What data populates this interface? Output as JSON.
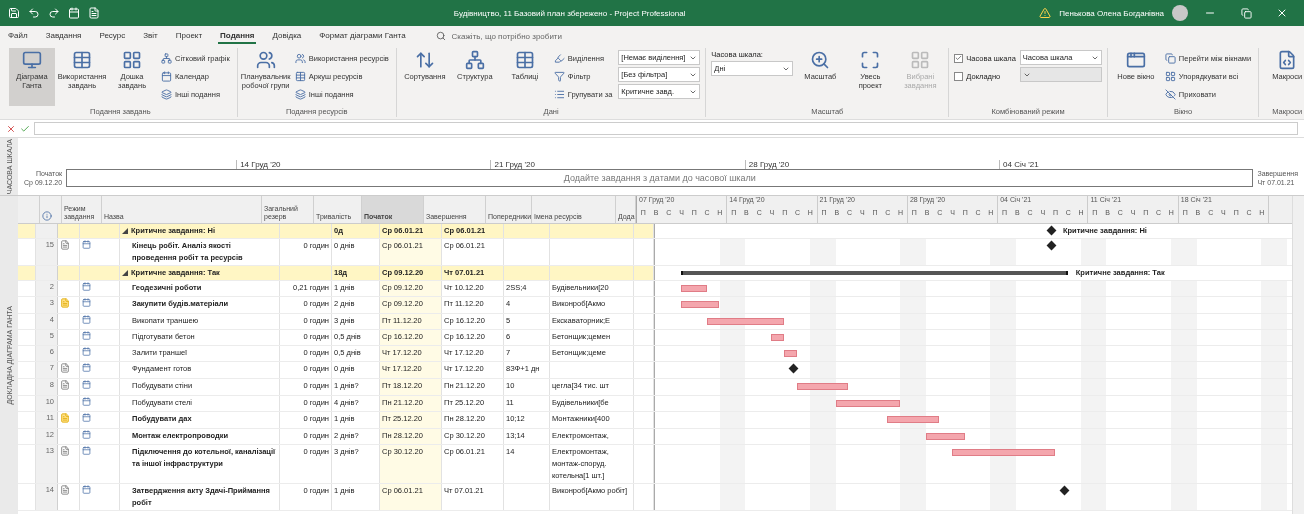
{
  "title_bar": {
    "title": "Будівництво, 11 Базовий план збережено - Project Professional",
    "user": "Пенькова Олена Богданівна"
  },
  "ribbon_tabs": [
    {
      "label": "Файл",
      "selected": false
    },
    {
      "label": "Завдання",
      "selected": false
    },
    {
      "label": "Ресурс",
      "selected": false
    },
    {
      "label": "Звіт",
      "selected": false
    },
    {
      "label": "Проект",
      "selected": false
    },
    {
      "label": "Подання",
      "selected": true
    },
    {
      "label": "Довідка",
      "selected": false
    },
    {
      "label": "Формат діаграми Ганта",
      "selected": false
    }
  ],
  "tell_me": {
    "placeholder": "Скажіть, що потрібно зробити"
  },
  "ribbon_groups": [
    {
      "title": "Подання завдань",
      "items": [
        {
          "kind": "large",
          "label": "Діаграма Ганта",
          "selected": true
        },
        {
          "kind": "large",
          "label": "Використання завдань",
          "selected": false
        },
        {
          "kind": "large",
          "label": "Дошка завдань",
          "selected": false
        },
        {
          "kind": "small",
          "label": "Сітковий графік",
          "selected": false
        },
        {
          "kind": "small",
          "label": "Календар",
          "selected": false
        },
        {
          "kind": "small",
          "label": "Інші подання",
          "selected": false
        }
      ]
    },
    {
      "title": "Подання ресурсів",
      "items": [
        {
          "kind": "large",
          "label": "Планувальник робочої групи",
          "selected": false
        },
        {
          "kind": "small",
          "label": "Використання ресурсів",
          "selected": false
        },
        {
          "kind": "small",
          "label": "Аркуш ресурсів",
          "selected": false
        },
        {
          "kind": "small",
          "label": "Інші подання",
          "selected": false
        }
      ]
    },
    {
      "title": "Дані",
      "items": [
        {
          "kind": "large",
          "label": "Сортування"
        },
        {
          "kind": "large",
          "label": "Структура"
        },
        {
          "kind": "large",
          "label": "Таблиці"
        },
        {
          "kind": "small",
          "label": "Виділення"
        },
        {
          "kind": "small",
          "label": "Фільтр"
        },
        {
          "kind": "small",
          "label": "Групувати за"
        },
        {
          "kind": "select",
          "value": "[Немає виділення]"
        },
        {
          "kind": "select",
          "value": "[Без фільтра]"
        },
        {
          "kind": "select",
          "value": "Критичне завд."
        }
      ]
    },
    {
      "title": "Масштаб",
      "items": [
        {
          "kind": "labeled_select",
          "label": "Часова шкала:",
          "value": "Дні"
        },
        {
          "kind": "large",
          "label": "Масштаб"
        },
        {
          "kind": "large",
          "label": "Увесь проект"
        },
        {
          "kind": "large",
          "label": "Вибрані завдання",
          "disabled": true
        }
      ]
    },
    {
      "title": "Комбінований режим",
      "items": [
        {
          "kind": "checkbox",
          "label": "Часова шкала",
          "checked": true
        },
        {
          "kind": "checkbox",
          "label": "Докладно",
          "checked": false
        },
        {
          "kind": "select",
          "value": "Часова шкала"
        },
        {
          "kind": "select",
          "disabled": true
        }
      ]
    },
    {
      "title": "Вікно",
      "items": [
        {
          "kind": "large",
          "label": "Нове вікно"
        },
        {
          "kind": "small",
          "label": "Перейти між вікнами"
        },
        {
          "kind": "small",
          "label": "Упорядкувати всі"
        },
        {
          "kind": "small",
          "label": "Приховати"
        }
      ]
    },
    {
      "title": "Макроси",
      "items": [
        {
          "kind": "large",
          "label": "Макроси"
        }
      ]
    }
  ],
  "timeline": {
    "label": "ЧАСОВА ШКАЛА",
    "start_label": "Початок",
    "start": "Ср 09.12.20",
    "finish_label": "Завершення",
    "finish": "Чт 07.01.21",
    "hint": "Додайте завдання з датами до часової шкали",
    "ticks": [
      "14 Груд '20",
      "21 Груд '20",
      "28 Груд '20",
      "04 Січ '21"
    ]
  },
  "table": {
    "side_label": "ДОКЛАДНА ДІАГРАМА ГАНТА",
    "columns": [
      {
        "label": "Режим завдання",
        "selected": false
      },
      {
        "label": "Назва",
        "selected": false
      },
      {
        "label": "Загальний резерв",
        "selected": false
      },
      {
        "label": "Тривалість",
        "selected": false
      },
      {
        "label": "Початок",
        "selected": true
      },
      {
        "label": "Завершення",
        "selected": false
      },
      {
        "label": "Попередники",
        "selected": false
      },
      {
        "label": "Імена ресурсів",
        "selected": false
      },
      {
        "label": "Дода",
        "selected": false
      }
    ],
    "groups": [
      {
        "label": "Критичне завдання: Ні",
        "duration": "0д",
        "start": "Ср 06.01.21",
        "finish": "Ср 06.01.21",
        "gantt_label": "Критичне завдання: Ні",
        "tasks": [
          {
            "kind": "milestone",
            "id": "15",
            "indicator": {
              "kind": "note"
            },
            "name": "Кінець робіт. Аналіз якості проведення робіт та ресурсів",
            "bold": true,
            "slack": "0 годин",
            "duration": "0 днів",
            "start": "Ср 06.01.21",
            "finish": "Ср 06.01.21"
          }
        ]
      },
      {
        "label": "Критичне завдання: Так",
        "duration": "18д",
        "start": "Ср 09.12.20",
        "finish": "Чт 07.01.21",
        "gantt_label": "Критичне завдання: Так",
        "tasks": [
          {
            "kind": "task",
            "id": "2",
            "name": "Геодезичні роботи",
            "bold": true,
            "slack": "0,21 годин",
            "duration": "1 днів",
            "start": "Ср 09.12.20",
            "finish": "Чт 10.12.20",
            "predecessors": "2SS;4",
            "resources": "Будівельники[20"
          },
          {
            "kind": "task",
            "id": "3",
            "indicator": {
              "kind": "flag"
            },
            "name": "Закупити будів.матеріали",
            "bold": true,
            "slack": "0 годин",
            "duration": "2 днів",
            "start": "Ср 09.12.20",
            "finish": "Пт 11.12.20",
            "predecessors": "4",
            "resources": "Виконроб[Акмо"
          },
          {
            "kind": "task",
            "id": "4",
            "name": "Викопати траншею",
            "bold": false,
            "slack": "0 годин",
            "duration": "3 днів",
            "start": "Пт 11.12.20",
            "finish": "Ср 16.12.20",
            "predecessors": "5",
            "resources": "Екскаваторник;Е"
          },
          {
            "kind": "task",
            "id": "5",
            "name": "Підготувати бетон",
            "bold": false,
            "slack": "0 годин",
            "duration": "0,5 днів",
            "start": "Ср 16.12.20",
            "finish": "Ср 16.12.20",
            "predecessors": "6",
            "resources": "Бетонщик;цемен"
          },
          {
            "kind": "task",
            "id": "6",
            "name": "Залити траншеї",
            "bold": false,
            "slack": "0 годин",
            "duration": "0,5 днів",
            "start": "Чт 17.12.20",
            "finish": "Чт 17.12.20",
            "predecessors": "7",
            "resources": "Бетонщик;цеме"
          },
          {
            "kind": "milestone",
            "id": "7",
            "indicator": {
              "kind": "note"
            },
            "name": "Фундамент готов",
            "bold": false,
            "slack": "0 годин",
            "duration": "0 днів",
            "start": "Чт 17.12.20",
            "finish": "Чт 17.12.20",
            "predecessors": "8ЗФ+1 дн"
          },
          {
            "kind": "task",
            "id": "8",
            "indicator": {
              "kind": "note"
            },
            "name": "Побудувати стіни",
            "bold": false,
            "slack": "0 годин",
            "duration": "1 днів?",
            "start": "Пт 18.12.20",
            "finish": "Пн 21.12.20",
            "predecessors": "10",
            "resources": "цегла[34 тис. шт"
          },
          {
            "kind": "task",
            "id": "10",
            "name": "Побудувати стелі",
            "bold": false,
            "slack": "0 годин",
            "duration": "4 днів?",
            "start": "Пн 21.12.20",
            "finish": "Пт 25.12.20",
            "predecessors": "11",
            "resources": "Будівельники[бе"
          },
          {
            "kind": "task",
            "id": "11",
            "indicator": {
              "kind": "flag"
            },
            "name": "Побудувати дах",
            "bold": true,
            "slack": "0 годин",
            "duration": "1 днів",
            "start": "Пт 25.12.20",
            "finish": "Пн 28.12.20",
            "predecessors": "10;12",
            "resources": "Монтажники[400"
          },
          {
            "kind": "task",
            "id": "12",
            "name": "Монтаж електропроводки",
            "bold": true,
            "slack": "0 годин",
            "duration": "2 днів?",
            "start": "Пн 28.12.20",
            "finish": "Ср 30.12.20",
            "predecessors": "13;14",
            "resources": "Електромонтаж,"
          },
          {
            "kind": "task",
            "id": "13",
            "indicator": {
              "kind": "note"
            },
            "name": "Підключення до котельної, каналізації та іншої інфраструктури",
            "bold": true,
            "slack": "0 годин",
            "duration": "3 днів?",
            "start": "Ср 30.12.20",
            "finish": "Ср 06.01.21",
            "predecessors": "14",
            "resources": "Електромонтаж, монтаж-споруд. котельна[1 шт.]"
          },
          {
            "kind": "milestone",
            "id": "14",
            "indicator": {
              "kind": "note"
            },
            "name": "Затвердження акту Здачі-Приймання робіт",
            "bold": true,
            "slack": "0 годин",
            "duration": "1 днів",
            "start": "Ср 06.01.21",
            "finish": "Чт 07.01.21",
            "resources": "Виконроб[Акмо робіт]"
          }
        ]
      }
    ]
  },
  "gantt": {
    "weeks": [
      {
        "label": "07 Груд '20",
        "days": [
          "П",
          "В",
          "С",
          "Ч",
          "П",
          "С",
          "Н"
        ]
      },
      {
        "label": "14 Груд '20",
        "days": [
          "П",
          "В",
          "С",
          "Ч",
          "П",
          "С",
          "Н"
        ]
      },
      {
        "label": "21 Груд '20",
        "days": [
          "П",
          "В",
          "С",
          "Ч",
          "П",
          "С",
          "Н"
        ]
      },
      {
        "label": "28 Груд '20",
        "days": [
          "П",
          "В",
          "С",
          "Ч",
          "П",
          "С",
          "Н"
        ]
      },
      {
        "label": "04 Січ '21",
        "days": [
          "П",
          "В",
          "С",
          "Ч",
          "П",
          "С",
          "Н"
        ]
      },
      {
        "label": "11 Січ '21",
        "days": [
          "П",
          "В",
          "С",
          "Ч",
          "П",
          "С",
          "Н"
        ]
      },
      {
        "label": "18 Січ '21",
        "days": [
          "П",
          "В",
          "С",
          "Ч",
          "П",
          "С",
          "Н"
        ]
      }
    ]
  }
}
